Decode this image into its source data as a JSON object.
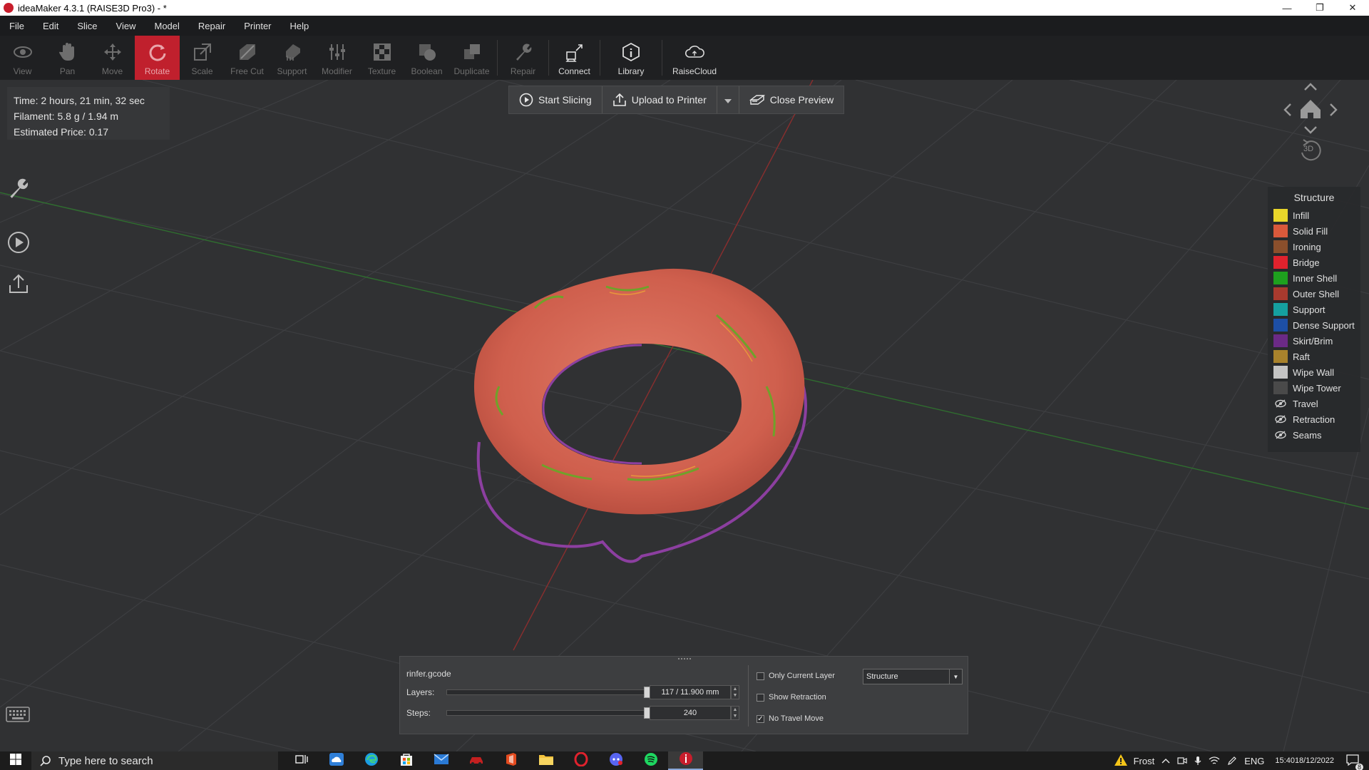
{
  "window": {
    "title": "ideaMaker 4.3.1 (RAISE3D Pro3) - *",
    "controls": {
      "minimize": "—",
      "restore": "❐",
      "close": "✕"
    }
  },
  "menu": [
    "File",
    "Edit",
    "Slice",
    "View",
    "Model",
    "Repair",
    "Printer",
    "Help"
  ],
  "toolbar": {
    "tools": [
      {
        "label": "View",
        "icon": "eye-icon"
      },
      {
        "label": "Pan",
        "icon": "hand-icon"
      },
      {
        "label": "Move",
        "icon": "move-icon"
      },
      {
        "label": "Rotate",
        "icon": "rotate-icon",
        "active": true
      },
      {
        "label": "Scale",
        "icon": "scale-icon"
      },
      {
        "label": "Free Cut",
        "icon": "cut-icon"
      },
      {
        "label": "Support",
        "icon": "support-icon"
      },
      {
        "label": "Modifier",
        "icon": "modifier-icon"
      },
      {
        "label": "Texture",
        "icon": "texture-icon"
      },
      {
        "label": "Boolean",
        "icon": "boolean-icon"
      },
      {
        "label": "Duplicate",
        "icon": "duplicate-icon"
      },
      {
        "label": "Repair",
        "icon": "wrench-icon"
      },
      {
        "label": "Connect",
        "icon": "connect-icon"
      },
      {
        "label": "Library",
        "icon": "library-icon"
      },
      {
        "label": "RaiseCloud",
        "icon": "cloud-icon"
      }
    ]
  },
  "info": {
    "time": "Time: 2 hours, 21 min, 32 sec",
    "filament": "Filament: 5.8 g / 1.94 m",
    "price": "Estimated Price: 0.17"
  },
  "actions": {
    "start_slicing": "Start Slicing",
    "upload": "Upload to Printer",
    "close_preview": "Close Preview"
  },
  "legend": {
    "title": "Structure",
    "items": [
      {
        "label": "Infill",
        "color": "#e8d62a"
      },
      {
        "label": "Solid Fill",
        "color": "#d9593b"
      },
      {
        "label": "Ironing",
        "color": "#8a4f2c"
      },
      {
        "label": "Bridge",
        "color": "#e0222d"
      },
      {
        "label": "Inner Shell",
        "color": "#1ea01e"
      },
      {
        "label": "Outer Shell",
        "color": "#a83a2e"
      },
      {
        "label": "Support",
        "color": "#15a0a0"
      },
      {
        "label": "Dense Support",
        "color": "#1d4fa6"
      },
      {
        "label": "Skirt/Brim",
        "color": "#6b2a86"
      },
      {
        "label": "Raft",
        "color": "#a8822c"
      },
      {
        "label": "Wipe Wall",
        "color": "#c4c4c4"
      },
      {
        "label": "Wipe Tower",
        "color": "#4a4a4a"
      }
    ],
    "toggles": [
      "Travel",
      "Retraction",
      "Seams"
    ]
  },
  "layers": {
    "file": "rinfer.gcode",
    "layers_label": "Layers:",
    "layers_value": "117 / 11.900 mm",
    "layers_fraction": 1.0,
    "steps_label": "Steps:",
    "steps_value": "240",
    "steps_fraction": 1.0,
    "only_current_layer": {
      "label": "Only Current Layer",
      "checked": false
    },
    "show_retraction": {
      "label": "Show Retraction",
      "checked": false
    },
    "no_travel_move": {
      "label": "No Travel Move",
      "checked": true
    },
    "view_mode": "Structure"
  },
  "nav": {
    "view_3d": "3D"
  },
  "taskbar": {
    "search_placeholder": "Type here to search",
    "weather": "Frost",
    "language": "ENG",
    "time": "15:40",
    "date": "18/12/2022",
    "notifications": "8"
  }
}
